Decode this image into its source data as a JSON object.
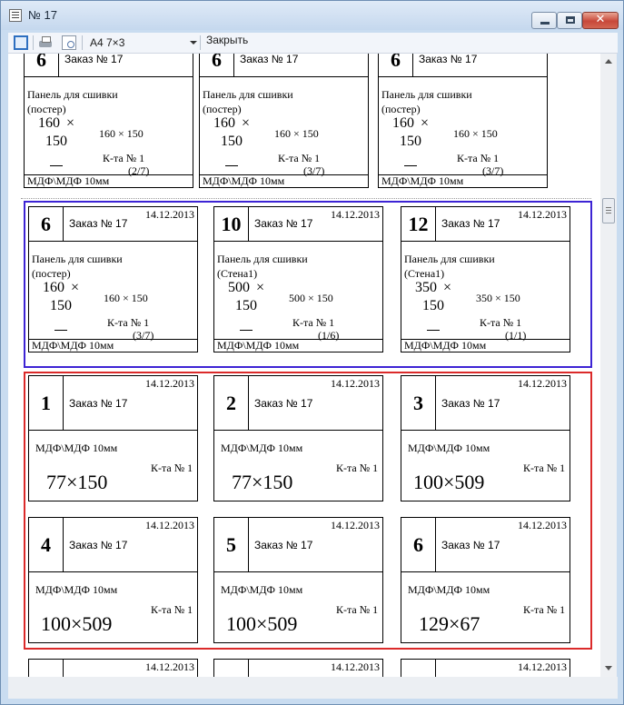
{
  "window": {
    "title": "№ 17",
    "close_glyph": "✕"
  },
  "toolbar": {
    "page_icon": "page-view-icon",
    "print_icon": "printer-icon",
    "preview_icon": "print-preview-icon",
    "paper_size": "A4 7×3",
    "close_label": "Закрыть"
  },
  "cards_partial": [
    {
      "num": "6",
      "order": "Заказ № 17",
      "title": "Панель для сшивки",
      "subtitle": "(постер)",
      "w": "160",
      "h": "150",
      "times": "×",
      "dims": "160 × 150",
      "kit": "К-та № 1",
      "frac": "(2/7)",
      "material": "МДФ\\МДФ 10мм"
    },
    {
      "num": "6",
      "order": "Заказ № 17",
      "title": "Панель для сшивки",
      "subtitle": "(постер)",
      "w": "160",
      "h": "150",
      "times": "×",
      "dims": "160 × 150",
      "kit": "К-та № 1",
      "frac": "(3/7)",
      "material": "МДФ\\МДФ 10мм"
    },
    {
      "num": "6",
      "order": "Заказ № 17",
      "title": "Панель для сшивки",
      "subtitle": "(постер)",
      "w": "160",
      "h": "150",
      "times": "×",
      "dims": "160 × 150",
      "kit": "К-та № 1",
      "frac": "(3/7)",
      "material": "МДФ\\МДФ 10мм"
    }
  ],
  "cards_panel": [
    {
      "num": "6",
      "order": "Заказ № 17",
      "date": "14.12.2013",
      "title": "Панель для сшивки",
      "subtitle": "(постер)",
      "w": "160",
      "h": "150",
      "times": "×",
      "dims": "160 × 150",
      "kit": "К-та № 1",
      "frac": "(3/7)",
      "material": "МДФ\\МДФ 10мм"
    },
    {
      "num": "10",
      "order": "Заказ № 17",
      "date": "14.12.2013",
      "title": "Панель для сшивки",
      "subtitle": "(Стена1)",
      "w": "500",
      "h": "150",
      "times": "×",
      "dims": "500 × 150",
      "kit": "К-та № 1",
      "frac": "(1/6)",
      "material": "МДФ\\МДФ 10мм"
    },
    {
      "num": "12",
      "order": "Заказ № 17",
      "date": "14.12.2013",
      "title": "Панель для сшивки",
      "subtitle": "(Стена1)",
      "w": "350",
      "h": "150",
      "times": "×",
      "dims": "350 × 150",
      "kit": "К-та № 1",
      "frac": "(1/1)",
      "material": "МДФ\\МДФ 10мм"
    }
  ],
  "cards_detail": [
    {
      "num": "1",
      "order": "Заказ № 17",
      "date": "14.12.2013",
      "material": "МДФ\\МДФ 10мм",
      "kit": "К-та № 1",
      "size": "77×150"
    },
    {
      "num": "2",
      "order": "Заказ № 17",
      "date": "14.12.2013",
      "material": "МДФ\\МДФ 10мм",
      "kit": "К-та № 1",
      "size": "77×150"
    },
    {
      "num": "3",
      "order": "Заказ № 17",
      "date": "14.12.2013",
      "material": "МДФ\\МДФ 10мм",
      "kit": "К-та № 1",
      "size": "100×509"
    },
    {
      "num": "4",
      "order": "Заказ № 17",
      "date": "14.12.2013",
      "material": "МДФ\\МДФ 10мм",
      "kit": "К-та № 1",
      "size": "100×509"
    },
    {
      "num": "5",
      "order": "Заказ № 17",
      "date": "14.12.2013",
      "material": "МДФ\\МДФ 10мм",
      "kit": "К-та № 1",
      "size": "100×509"
    },
    {
      "num": "6",
      "order": "Заказ № 17",
      "date": "14.12.2013",
      "material": "МДФ\\МДФ 10мм",
      "kit": "К-та № 1",
      "size": "129×67"
    }
  ],
  "cards_bottom": [
    {
      "date": "14.12.2013"
    },
    {
      "date": "14.12.2013"
    },
    {
      "date": "14.12.2013"
    }
  ]
}
